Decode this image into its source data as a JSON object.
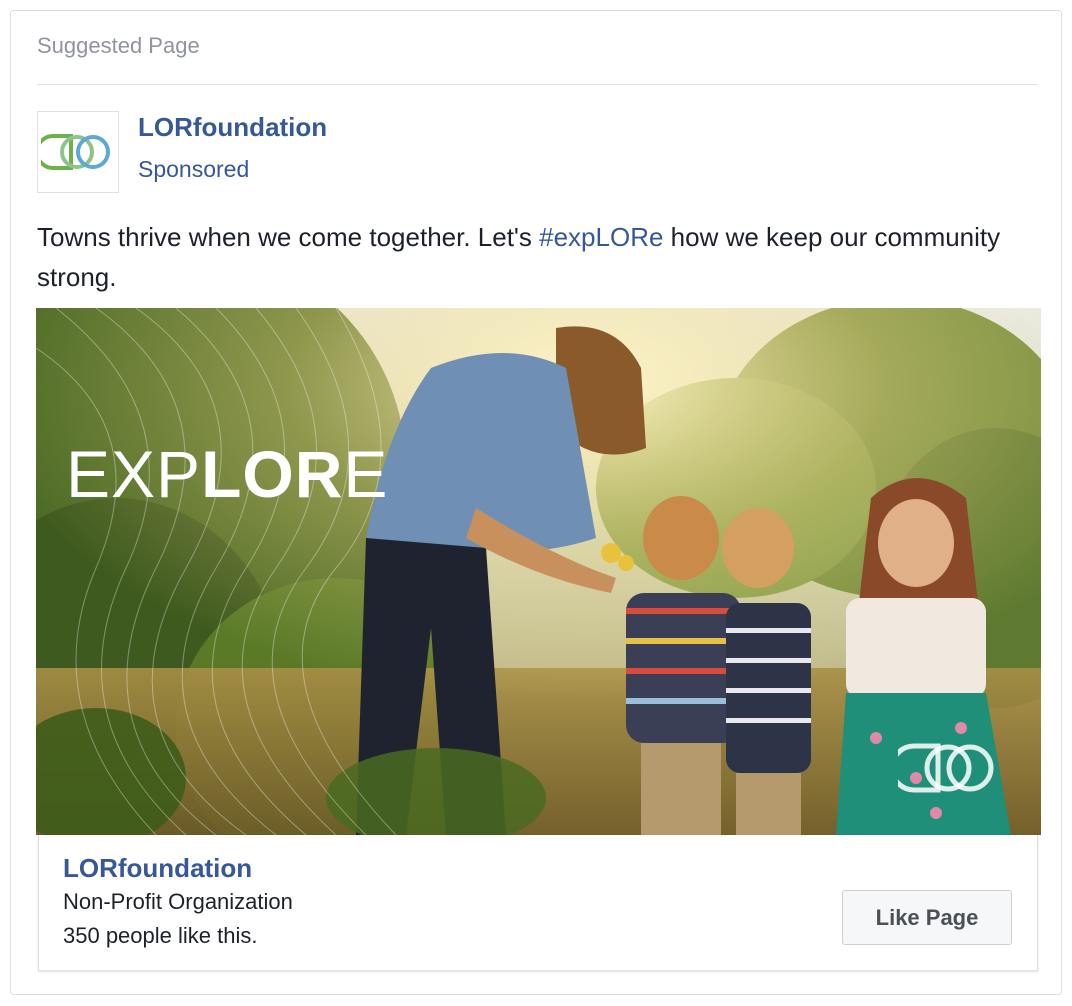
{
  "card": {
    "header_label": "Suggested Page"
  },
  "post": {
    "page_name": "LORfoundation",
    "sponsored_label": "Sponsored",
    "text_before": "Towns thrive when we come together. Let's ",
    "hashtag": "#expLORe",
    "text_after": " how we keep our community strong."
  },
  "image": {
    "overlay_thin_1": "EXP",
    "overlay_bold": "LOR",
    "overlay_thin_2": "E"
  },
  "footer": {
    "page_name": "LORfoundation",
    "category": "Non-Profit Organization",
    "likes": "350 people like this.",
    "like_button_label": "Like Page"
  },
  "colors": {
    "link_blue": "#365899",
    "logo_green": "#6bb24a",
    "logo_blue": "#5ca8d6",
    "border": "#dddfe2"
  },
  "icons": {
    "avatar": "lor-logo-icon",
    "photo_watermark": "lor-logo-icon"
  }
}
